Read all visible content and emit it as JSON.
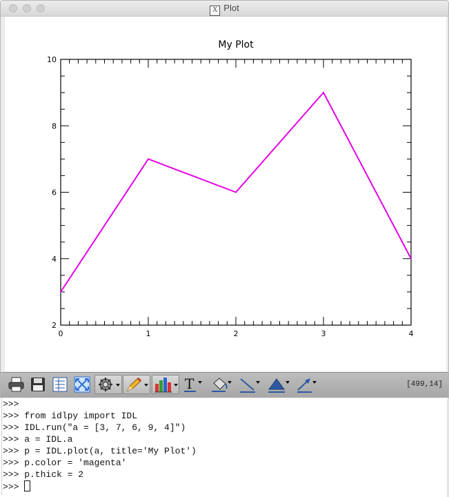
{
  "window": {
    "title": "Plot",
    "title_icon": "x11-icon",
    "title_icon_glyph": "X"
  },
  "plot": {
    "title": "My Plot",
    "color": "#e600e6"
  },
  "chart_data": {
    "type": "line",
    "title": "My Plot",
    "xlabel": "",
    "ylabel": "",
    "x": [
      0,
      1,
      2,
      3,
      4
    ],
    "series": [
      {
        "values": [
          3,
          7,
          6,
          9,
          4
        ]
      }
    ],
    "xlim": [
      0,
      4
    ],
    "ylim": [
      2,
      10
    ],
    "xticks": [
      0,
      1,
      2,
      3,
      4
    ],
    "xtick_labels": [
      "0",
      "1",
      "2",
      "3",
      "4"
    ],
    "yticks": [
      2,
      4,
      6,
      8,
      10
    ],
    "ytick_labels": [
      "2",
      "4",
      "6",
      "8",
      "10"
    ],
    "line_color": "#e600e6",
    "grid": false
  },
  "toolbar": {
    "buttons": [
      {
        "icon": "print-icon"
      },
      {
        "icon": "save-icon"
      },
      {
        "icon": "data-list-icon"
      },
      {
        "icon": "fit-window-icon"
      },
      {
        "icon": "settings-gear-icon"
      },
      {
        "icon": "pencil-icon"
      },
      {
        "icon": "bar-chart-icon"
      },
      {
        "icon": "text-tool-icon"
      },
      {
        "icon": "fill-color-icon"
      },
      {
        "icon": "line-tool-icon"
      },
      {
        "icon": "polygon-tool-icon"
      },
      {
        "icon": "arrow-tool-icon"
      }
    ],
    "coordinates": "[499,14]"
  },
  "console": {
    "lines": [
      ">>>",
      ">>> from idlpy import IDL",
      ">>> IDL.run(\"a = [3, 7, 6, 9, 4]\")",
      ">>> a = IDL.a",
      ">>> p = IDL.plot(a, title='My Plot')",
      ">>> p.color = 'magenta'",
      ">>> p.thick = 2"
    ],
    "prompt": ">>> "
  }
}
